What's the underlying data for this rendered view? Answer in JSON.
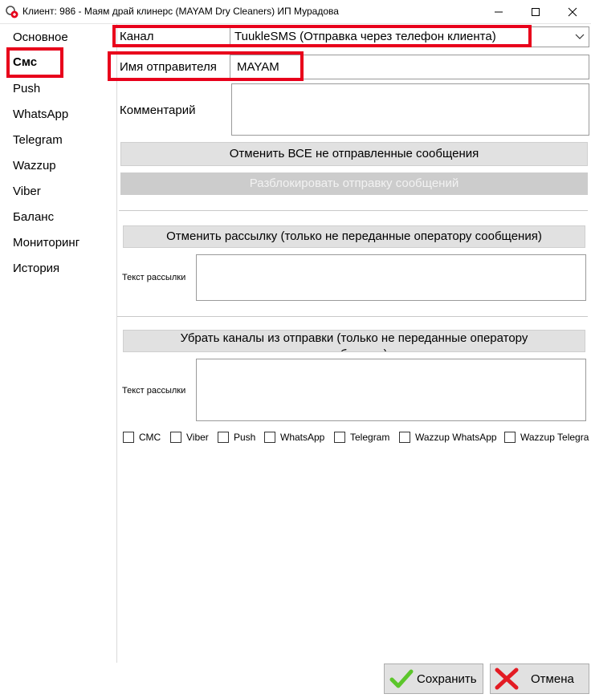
{
  "window": {
    "title": "Клиент: 986 - Маям драй клинерс (MAYAM Dry Cleaners) ИП Мурадова",
    "icon": "client-app-icon",
    "controls": [
      "minimize-icon",
      "maximize-icon",
      "close-icon"
    ]
  },
  "sidebar": {
    "items": [
      {
        "label": "Основное"
      },
      {
        "label": "Смс"
      },
      {
        "label": "Push"
      },
      {
        "label": "WhatsApp"
      },
      {
        "label": "Telegram"
      },
      {
        "label": "Wazzup"
      },
      {
        "label": "Viber"
      },
      {
        "label": "Баланс"
      },
      {
        "label": "Мониторинг"
      },
      {
        "label": "История"
      }
    ],
    "selected_index": 1
  },
  "form": {
    "channel_label": "Канал",
    "channel_value": "TuukleSMS (Отправка через телефон клиента)",
    "sender_label": "Имя отправителя",
    "sender_value": "MAYAM",
    "comment_label": "Комментарий",
    "comment_value": "",
    "cancel_all_button": "Отменить ВСЕ не отправленные сообщения",
    "unblock_button": "Разблокировать отправку сообщений",
    "cancel_mailing_button": "Отменить рассылку (только не переданные оператору сообщения)",
    "mailing_text_label_1": "Текст рассылки",
    "mailing_text_value_1": "",
    "remove_channels_button": "Убрать каналы из отправки (только не переданные оператору сообщения)",
    "mailing_text_label_2": "Текст рассылки",
    "mailing_text_value_2": "",
    "checkboxes": [
      {
        "label": "СМС",
        "checked": false
      },
      {
        "label": "Viber",
        "checked": false
      },
      {
        "label": "Push",
        "checked": false
      },
      {
        "label": "WhatsApp",
        "checked": false
      },
      {
        "label": "Telegram",
        "checked": false
      },
      {
        "label": "Wazzup WhatsApp",
        "checked": false
      },
      {
        "label": "Wazzup Telegram",
        "checked": false
      }
    ]
  },
  "footer": {
    "save_label": "Сохранить",
    "cancel_label": "Отмена",
    "save_icon": "green-checkmark-icon",
    "cancel_icon": "red-cross-icon"
  },
  "colors": {
    "highlight": "#e8001b",
    "button_bg": "#e1e1e1",
    "disabled_bg": "#cccccc"
  }
}
